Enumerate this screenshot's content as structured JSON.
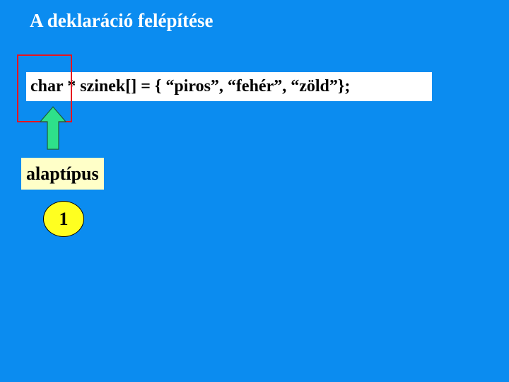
{
  "slide": {
    "title": "A deklaráció felépítése",
    "code_line": "char * szinek[] = { “piros”, “fehér”, “zöld”};",
    "callout_label": "alaptípus",
    "step_number": "1"
  },
  "colors": {
    "background": "#0b8cf0",
    "title_text": "#ffffff",
    "code_background": "#ffffff",
    "highlight_frame": "#e8141e",
    "arrow_fill": "#2ee08a",
    "label_background": "#ffffc8",
    "number_oval_fill": "#ffff20"
  },
  "icons": {
    "pointer_arrow": "arrow-up-icon"
  }
}
